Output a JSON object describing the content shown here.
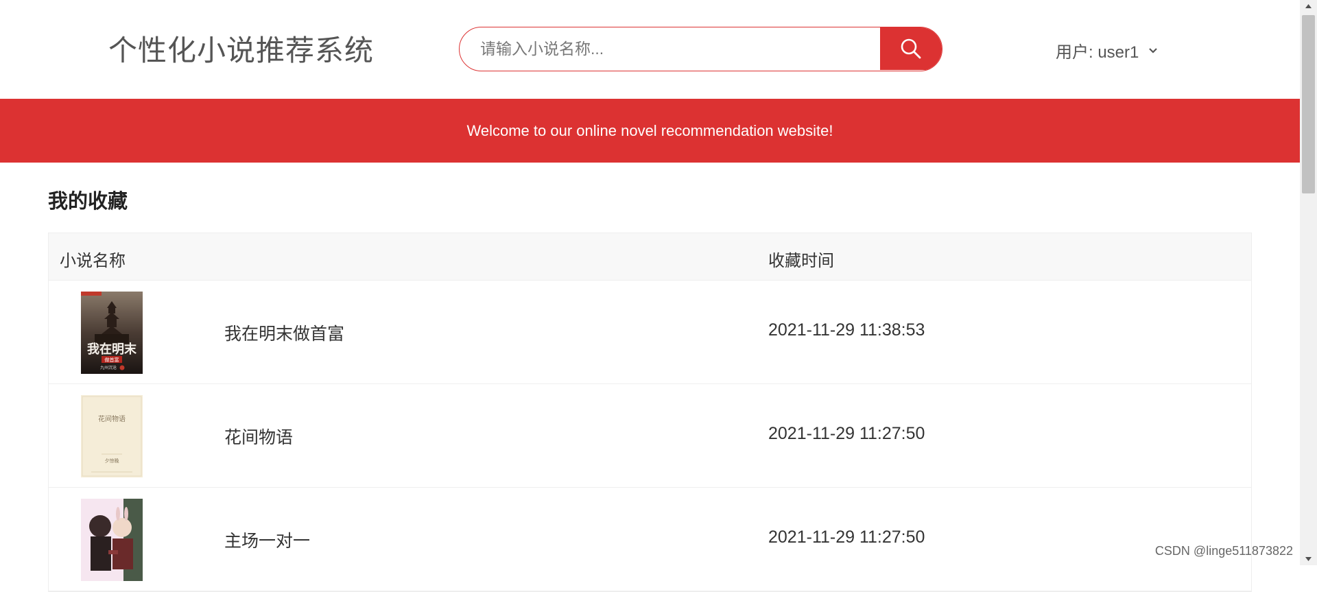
{
  "header": {
    "site_title": "个性化小说推荐系统",
    "search": {
      "placeholder": "请输入小说名称..."
    },
    "user_label": "用户: user1"
  },
  "banner": {
    "text": "Welcome to our online novel recommendation website!"
  },
  "favorites": {
    "title": "我的收藏",
    "columns": {
      "name": "小说名称",
      "time": "收藏时间"
    },
    "rows": [
      {
        "title": "我在明末做首富",
        "time": "2021-11-29 11:38:53",
        "cover": {
          "text": "我在明末",
          "subtext": "做首富",
          "author": "九州沉沧"
        }
      },
      {
        "title": "花间物语",
        "time": "2021-11-29 11:27:50",
        "cover": {
          "text": "花间物语",
          "author": "夕惊晚"
        }
      },
      {
        "title": "主场一对一",
        "time": "2021-11-29 11:27:50"
      }
    ]
  },
  "watermark": "CSDN @linge511873822",
  "colors": {
    "accent": "#dc3232",
    "header_bg": "#ffffff",
    "table_head_bg": "#f8f8f8"
  }
}
